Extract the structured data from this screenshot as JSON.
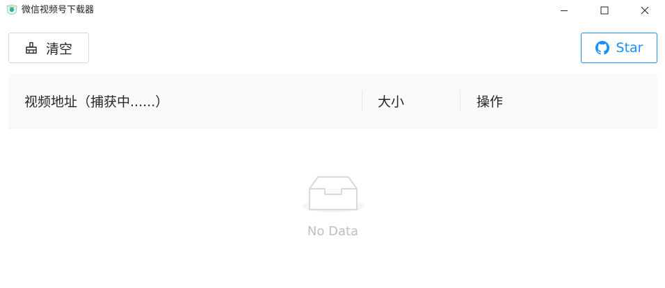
{
  "window": {
    "title": "微信视频号下载器",
    "icon": "app-logo-icon"
  },
  "toolbar": {
    "clear_label": "清空",
    "clear_icon": "broom-icon",
    "star_label": "Star",
    "star_icon": "github-icon"
  },
  "table": {
    "columns": [
      "视频地址（捕获中......）",
      "大小",
      "操作"
    ],
    "rows": [],
    "empty_text": "No Data"
  },
  "colors": {
    "accent": "#1890ff",
    "header_bg": "#fafafa",
    "muted_text": "#bfbfbf"
  }
}
